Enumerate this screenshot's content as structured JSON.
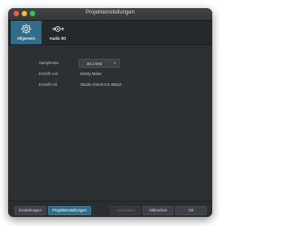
{
  "window": {
    "title": "Projekteinstellungen"
  },
  "tabs": [
    {
      "label": "Allgemein",
      "icon": "gear-icon"
    },
    {
      "label": "Audio I/O",
      "icon": "audio-io-icon"
    }
  ],
  "settings": {
    "samplerate": {
      "label": "Samplerate",
      "value": "44.1 kHz"
    },
    "created_by": {
      "label": "Erstellt von",
      "value": "Monty Maier"
    },
    "created_with": {
      "label": "Erstellt mit",
      "value": "Studio One/5.0.0.49510"
    }
  },
  "footer": {
    "buttons": [
      "Einstellungen",
      "Projekteinstellungen",
      "Anwenden",
      "Abbrechen",
      "OK"
    ]
  },
  "colors": {
    "accent": "#2f6d88",
    "background": "#2d3033"
  }
}
